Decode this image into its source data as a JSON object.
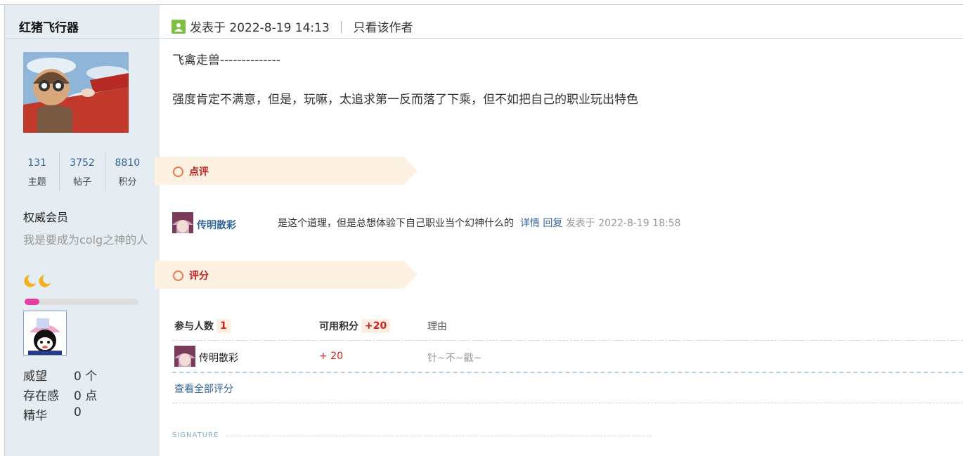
{
  "author": {
    "name": "红猪飞行器",
    "stats": [
      {
        "value": "131",
        "label": "主题"
      },
      {
        "value": "3752",
        "label": "帖子"
      },
      {
        "value": "8810",
        "label": "积分"
      }
    ],
    "group": "权威会员",
    "custom_title": "我是要成为colg之神的人",
    "level_progress": 0.13,
    "progress_color": "#e63fa4",
    "profile": [
      {
        "key": "威望",
        "value": "0 个"
      },
      {
        "key": "存在感",
        "value": "0 点"
      },
      {
        "key": "精华",
        "value": "0"
      }
    ]
  },
  "post": {
    "posted_at": "发表于 2022-8-19 14:13",
    "separator": "|",
    "only_author_link": "只看该作者",
    "lines": [
      "飞禽走兽--------------",
      "强度肯定不满意，但是，玩嘛，太追求第一反而落了下乘，但不如把自己的职业玩出特色"
    ]
  },
  "comments_section": {
    "title": "点评",
    "items": [
      {
        "user": "传明散彩",
        "text": "是这个道理，但是总想体验下自己职业当个幻神什么的",
        "detail_link": "详情",
        "reply_link": "回复",
        "time": "发表于 2022-8-19 18:58"
      }
    ]
  },
  "rating_section": {
    "title": "评分",
    "participants_label": "参与人数",
    "participants_count": "1",
    "points_label": "可用积分",
    "points_total": "+20",
    "reason_label": "理由",
    "rows": [
      {
        "user": "传明散彩",
        "score": "+ 20",
        "reason": "针~不~戳~"
      }
    ],
    "view_all": "查看全部评分"
  },
  "signature": {
    "label": "SIGNATURE"
  },
  "icons": {
    "post_icon": "post-status-icon",
    "moon": "moon-icon"
  },
  "colors": {
    "sidebar_bg": "#e5edf2",
    "link": "#336699",
    "accent_red": "#c41e1e"
  }
}
